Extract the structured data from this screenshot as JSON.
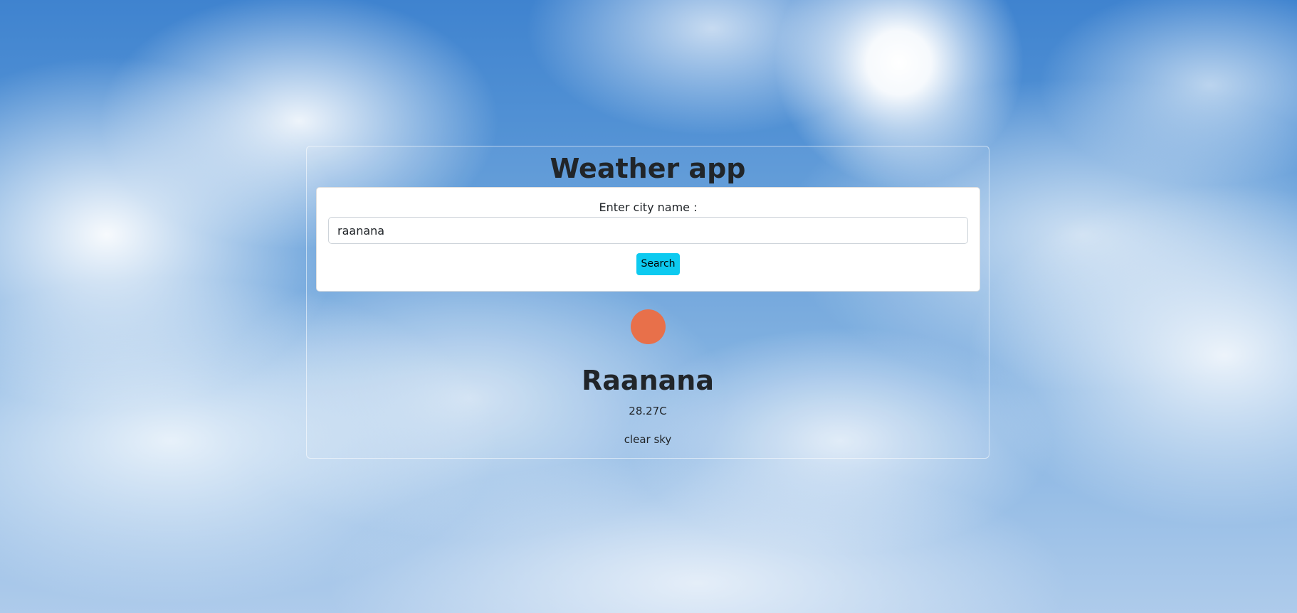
{
  "app": {
    "title": "Weather app"
  },
  "search": {
    "label": "Enter city name :",
    "input_value": "raanana",
    "button_label": "Search"
  },
  "weather": {
    "icon": "sun-icon",
    "city": "Raanana",
    "temperature": "28.27C",
    "description": "clear sky",
    "icon_color": "#e8704a"
  },
  "colors": {
    "button": "#0dcaf0",
    "card": "#ffffff",
    "text": "#212529"
  }
}
